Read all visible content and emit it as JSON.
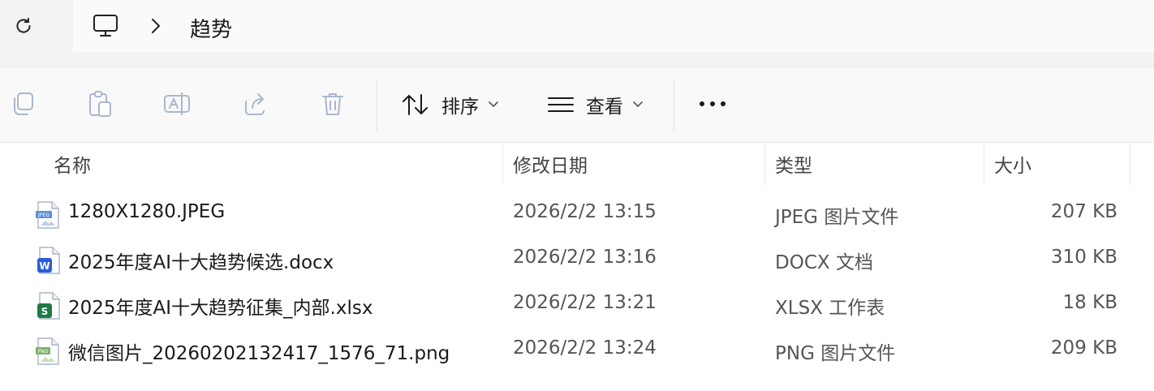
{
  "address_bar": {
    "breadcrumb": "趋势"
  },
  "toolbar": {
    "sort_label": "排序",
    "view_label": "查看"
  },
  "columns": {
    "name": "名称",
    "date": "修改日期",
    "type": "类型",
    "size": "大小"
  },
  "files": [
    {
      "name": "1280X1280.JPEG",
      "date": "2026/2/2 13:15",
      "type": "JPEG 图片文件",
      "size": "207 KB",
      "icon": "jpeg-file-icon"
    },
    {
      "name": "2025年度AI十大趋势候选.docx",
      "date": "2026/2/2 13:16",
      "type": "DOCX 文档",
      "size": "310 KB",
      "icon": "word-file-icon"
    },
    {
      "name": "2025年度AI十大趋势征集_内部.xlsx",
      "date": "2026/2/2 13:21",
      "type": "XLSX 工作表",
      "size": "18 KB",
      "icon": "excel-file-icon"
    },
    {
      "name": "微信图片_20260202132417_1576_71.png",
      "date": "2026/2/2 13:24",
      "type": "PNG 图片文件",
      "size": "209 KB",
      "icon": "png-file-icon"
    }
  ],
  "colors": {
    "word_blue": "#2b5cd8",
    "excel_green": "#1e7a47"
  }
}
